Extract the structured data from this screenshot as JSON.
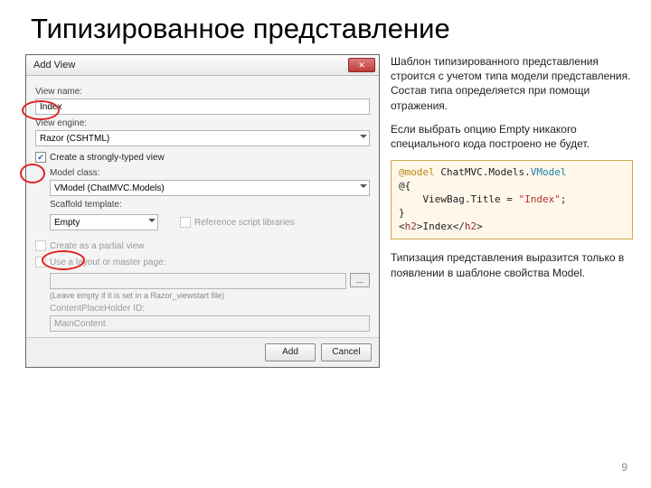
{
  "slide": {
    "title": "Типизированное представление",
    "page_number": "9"
  },
  "dialog": {
    "title": "Add View",
    "labels": {
      "view_name": "View name:",
      "view_engine": "View engine:",
      "model_class": "Model class:",
      "scaffold_template": "Scaffold template:",
      "leave_empty": "(Leave empty if it is set in a Razor_viewstart file)",
      "content_placeholder": "ContentPlaceHolder ID:"
    },
    "values": {
      "view_name": "Index",
      "view_engine": "Razor (CSHTML)",
      "model_class": "VModel (ChatMVC.Models)",
      "scaffold_template": "Empty",
      "content_placeholder": "MainContent"
    },
    "checkboxes": {
      "strongly_typed": "Create a strongly-typed view",
      "reference_libs": "Reference script libraries",
      "partial_view": "Create as a partial view",
      "use_layout": "Use a layout or master page:"
    },
    "buttons": {
      "add": "Add",
      "cancel": "Cancel",
      "browse": "..."
    }
  },
  "text": {
    "p1": "Шаблон типизированного представления строится с учетом типа модели представления.",
    "p2": "Состав типа определяется при помощи отражения.",
    "p3": "Если выбрать опцию Empty никакого специального кода построено не будет.",
    "p4": "Типизация представления выразится только в появлении в шаблоне свойства Model."
  },
  "code": {
    "l1a": "@model",
    "l1b": " ChatMVC.Models.",
    "l1c": "VModel",
    "l2": "@{",
    "l3a": "    ViewBag.Title = ",
    "l3b": "\"Index\"",
    "l3c": ";",
    "l4": "}",
    "l5a": "<",
    "l5b": "h2",
    "l5c": ">Index</",
    "l5d": "h2",
    "l5e": ">"
  }
}
